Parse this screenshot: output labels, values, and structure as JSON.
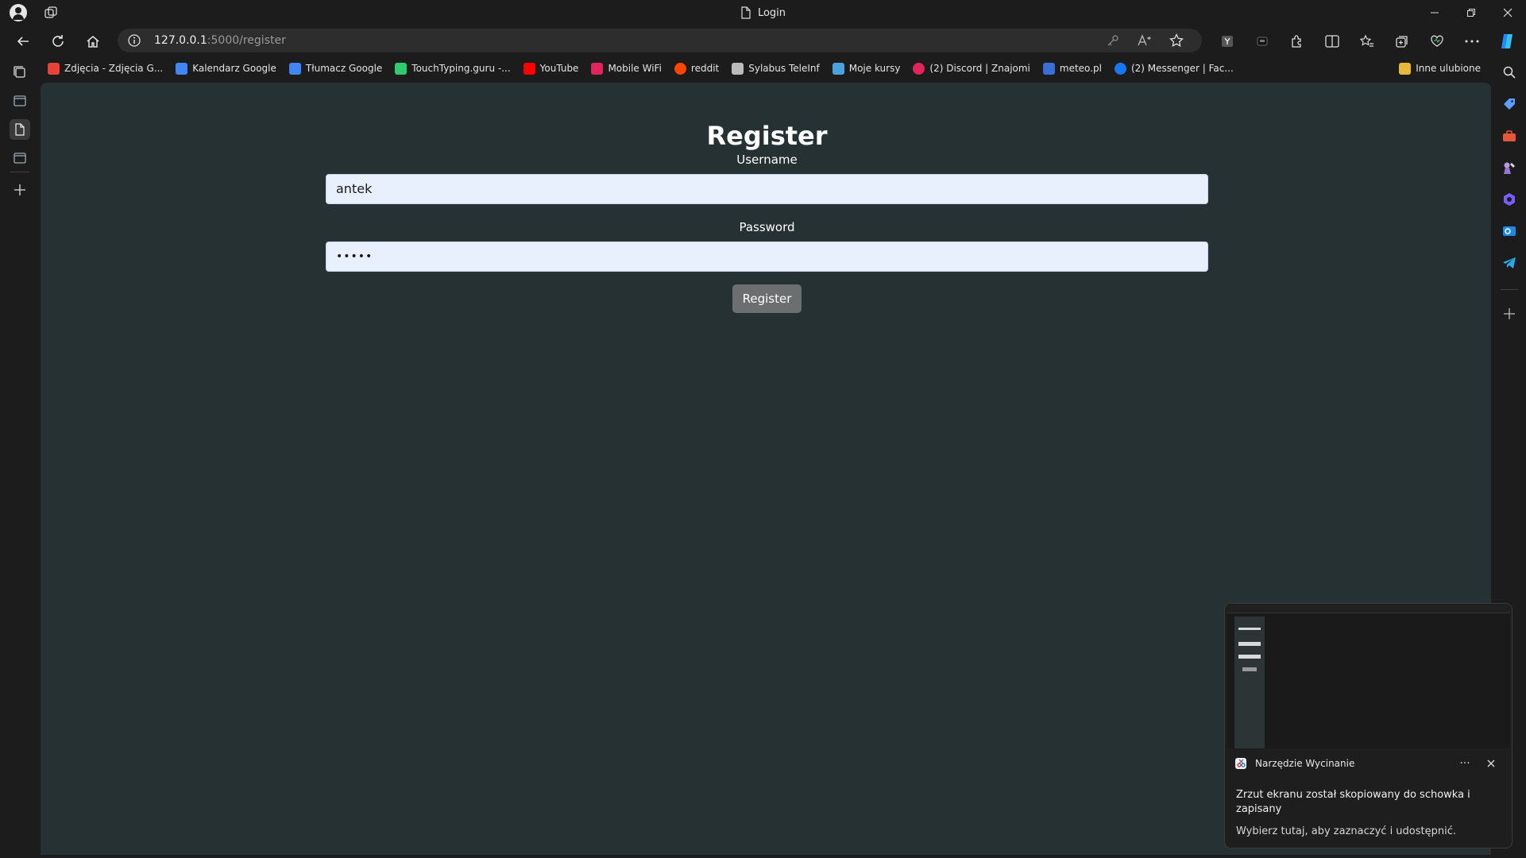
{
  "window": {
    "title": "Login",
    "controls": [
      "minimize",
      "restore",
      "close"
    ]
  },
  "address_bar": {
    "host": "127.0.0.1",
    "path": ":5000/register"
  },
  "favorites": [
    {
      "label": "Zdjęcia - Zdjęcia G...",
      "color": "#ea4335"
    },
    {
      "label": "Kalendarz Google",
      "color": "#4285f4"
    },
    {
      "label": "Tłumacz Google",
      "color": "#4285f4"
    },
    {
      "label": "TouchTyping.guru -...",
      "color": "#2ecc71"
    },
    {
      "label": "YouTube",
      "color": "#ff0000"
    },
    {
      "label": "Mobile WiFi",
      "color": "#e0245e"
    },
    {
      "label": "reddit",
      "color": "#ff4500"
    },
    {
      "label": "Sylabus TeleInf",
      "color": "#bbbbbb"
    },
    {
      "label": "Moje kursy",
      "color": "#4aa3df"
    },
    {
      "label": "(2) Discord | Znajomi",
      "color": "#e0245e"
    },
    {
      "label": "meteo.pl",
      "color": "#3a6fd8"
    },
    {
      "label": "(2) Messenger | Fac...",
      "color": "#1877f2"
    }
  ],
  "other_favorites": "Inne ulubione",
  "page": {
    "heading": "Register",
    "username_label": "Username",
    "username_value": "antek",
    "password_label": "Password",
    "password_value": "•••••",
    "submit_label": "Register"
  },
  "toast": {
    "app_name": "Narzędzie Wycinanie",
    "message": "Zrzut ekranu został skopiowany do schowka i zapisany",
    "hint": "Wybierz tutaj, aby zaznaczyć i udostępnić.",
    "more": "···"
  },
  "colors": {
    "page_background": "#253132",
    "chrome_background": "#1c1c1c",
    "input_background": "#e8f0fe",
    "button_background": "#6c6f70"
  }
}
